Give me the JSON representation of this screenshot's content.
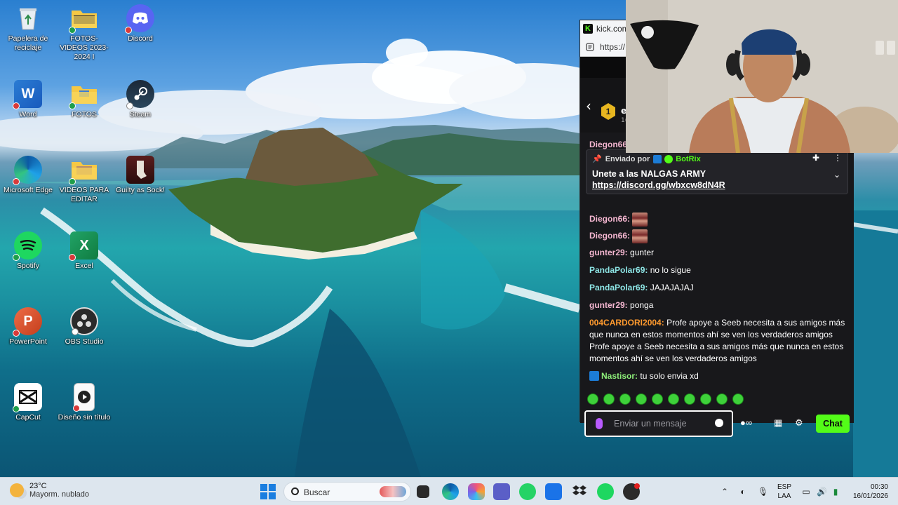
{
  "desktop": {
    "icons": [
      {
        "label": "Papelera de reciclaje",
        "icon": "recycle-bin-icon"
      },
      {
        "label": "FOTOS- VIDEOS 2023-2024 I",
        "icon": "folder-icon"
      },
      {
        "label": "Discord",
        "icon": "discord-icon"
      },
      {
        "label": "Word",
        "icon": "word-icon"
      },
      {
        "label": "FOTOS",
        "icon": "folder-icon"
      },
      {
        "label": "Steam",
        "icon": "steam-icon"
      },
      {
        "label": "Microsoft Edge",
        "icon": "edge-icon"
      },
      {
        "label": "VIDEOS PARA EDITAR",
        "icon": "folder-icon"
      },
      {
        "label": "Guilty as Sock!",
        "icon": "game-icon"
      },
      {
        "label": "Spotify",
        "icon": "spotify-icon"
      },
      {
        "label": "Excel",
        "icon": "excel-icon"
      },
      {
        "label": "PowerPoint",
        "icon": "powerpoint-icon"
      },
      {
        "label": "OBS Studio",
        "icon": "obs-icon"
      },
      {
        "label": "CapCut",
        "icon": "capcut-icon"
      },
      {
        "label": "Diseño sin título",
        "icon": "video-file-icon"
      }
    ]
  },
  "browser": {
    "tab_title": "kick.com",
    "url": "https://",
    "stream_level": "1",
    "streamer_initial": "e",
    "streamer_sub": "1(",
    "chat": {
      "peek_user": "Diegon66",
      "pinned": {
        "sent_by": "Enviado por",
        "bot_name": "BotRix",
        "message": "Unete a las NALGAS ARMY",
        "link": "https://discord.gg/wbxcw8dN4R"
      },
      "messages": [
        {
          "user": "Diegon66:",
          "text": "",
          "color": "#f4b6d0",
          "emote": true
        },
        {
          "user": "Diegon66:",
          "text": "",
          "color": "#f4b6d0",
          "emote": true
        },
        {
          "user": "gunter29:",
          "text": "gunter",
          "color": "#f4b6d0"
        },
        {
          "user": "PandaPolar69:",
          "text": "no lo sigue",
          "color": "#8ee6e6"
        },
        {
          "user": "PandaPolar69:",
          "text": "JAJAJAJAJ",
          "color": "#8ee6e6"
        },
        {
          "user": "gunter29:",
          "text": "ponga",
          "color": "#f4b6d0"
        },
        {
          "user": "004CARDORI2004:",
          "text": "Profe apoye a Seeb necesita a sus amigos más que nunca en estos momentos ahí se ven los verdaderos amigos Profe apoye a Seeb necesita a sus amigos más que nunca en estos momentos ahí se ven los verdaderos amigos",
          "color": "#ff9a2e"
        },
        {
          "user": "Nastisor:",
          "text": "tu solo envia xd",
          "color": "#8ef07a",
          "badge": true
        }
      ],
      "input_placeholder": "Enviar un mensaje",
      "send_label": "Chat"
    }
  },
  "taskbar": {
    "weather_temp": "23°C",
    "weather_desc": "Mayorm. nublado",
    "search_placeholder": "Buscar",
    "lang_1": "ESP",
    "lang_2": "LAA",
    "time": "00:30",
    "date": "16/01/2026"
  }
}
